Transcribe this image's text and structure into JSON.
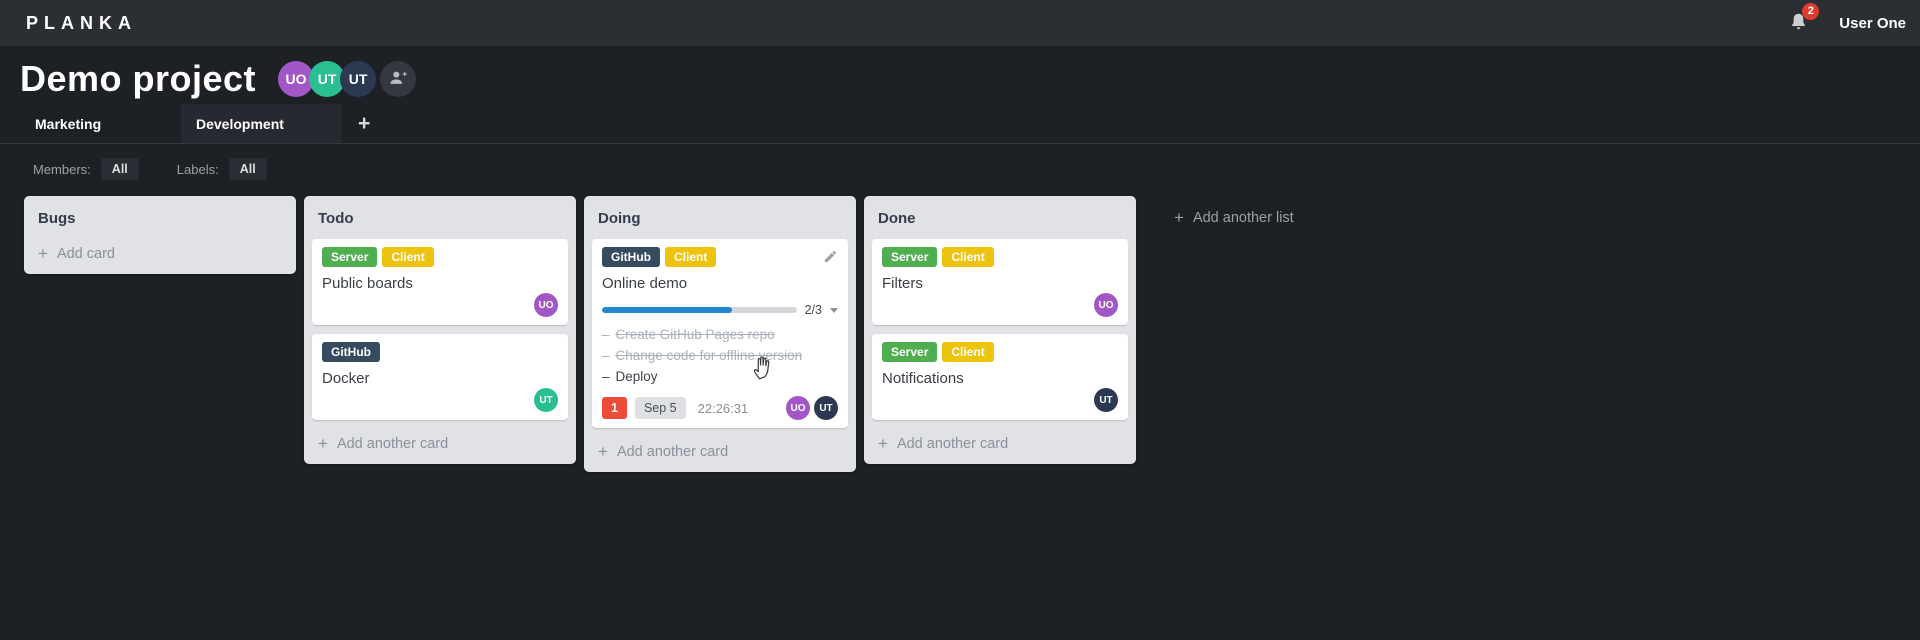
{
  "topbar": {
    "logo": "PLANKA",
    "notifications_count": "2",
    "user_name": "User One"
  },
  "project": {
    "title": "Demo project",
    "members": [
      {
        "initials": "UO",
        "color": "#a158c6"
      },
      {
        "initials": "UT",
        "color": "#2abf92"
      },
      {
        "initials": "UT",
        "color": "#2b3a52"
      }
    ]
  },
  "tabs": {
    "items": [
      {
        "label": "Marketing",
        "active": false
      },
      {
        "label": "Development",
        "active": true
      }
    ],
    "add_button": "+"
  },
  "filters": {
    "members_label": "Members:",
    "members_value": "All",
    "labels_label": "Labels:",
    "labels_value": "All"
  },
  "colors": {
    "progress_fill": "#2386d1",
    "notification_badge": "#ef4b3a",
    "label_green": "#4fae50",
    "label_yellow": "#edc30e",
    "label_navy": "#374b60"
  },
  "board": {
    "add_list_label": "Add another list",
    "lists": [
      {
        "title": "Bugs",
        "footer_label": "Add card",
        "cards": []
      },
      {
        "title": "Todo",
        "footer_label": "Add another card",
        "cards": [
          {
            "title": "Public boards",
            "labels": [
              {
                "name": "Server",
                "color": "#4fae50"
              },
              {
                "name": "Client",
                "color": "#edc30e"
              }
            ],
            "members": [
              {
                "initials": "UO",
                "color": "#a158c6"
              }
            ]
          },
          {
            "title": "Docker",
            "labels": [
              {
                "name": "GitHub",
                "color": "#374b60"
              }
            ],
            "members": [
              {
                "initials": "UT",
                "color": "#2abf92"
              }
            ]
          }
        ]
      },
      {
        "title": "Doing",
        "footer_label": "Add another card",
        "cards": [
          {
            "title": "Online demo",
            "editing": true,
            "labels": [
              {
                "name": "GitHub",
                "color": "#374b60"
              },
              {
                "name": "Client",
                "color": "#edc30e"
              }
            ],
            "progress": {
              "label": "2/3",
              "percent": 66.7
            },
            "tasks": [
              {
                "text": "Create GitHub Pages repo",
                "done": true
              },
              {
                "text": "Change code for offline version",
                "done": true
              },
              {
                "text": "Deploy",
                "done": false
              }
            ],
            "notification_count": "1",
            "due_date": "Sep 5",
            "timer": "22:26:31",
            "members": [
              {
                "initials": "UO",
                "color": "#a158c6"
              },
              {
                "initials": "UT",
                "color": "#2b3a52"
              }
            ]
          }
        ]
      },
      {
        "title": "Done",
        "footer_label": "Add another card",
        "cards": [
          {
            "title": "Filters",
            "labels": [
              {
                "name": "Server",
                "color": "#4fae50"
              },
              {
                "name": "Client",
                "color": "#edc30e"
              }
            ],
            "members": [
              {
                "initials": "UO",
                "color": "#a158c6"
              }
            ]
          },
          {
            "title": "Notifications",
            "labels": [
              {
                "name": "Server",
                "color": "#4fae50"
              },
              {
                "name": "Client",
                "color": "#edc30e"
              }
            ],
            "members": [
              {
                "initials": "UT",
                "color": "#2b3a52"
              }
            ]
          }
        ]
      }
    ]
  }
}
